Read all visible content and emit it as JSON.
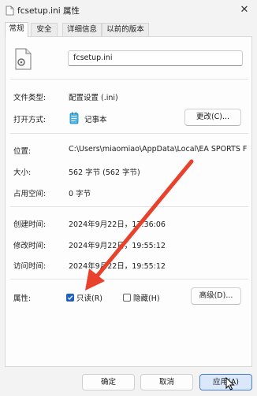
{
  "window": {
    "title": "fcsetup.ini 属性",
    "close_label": "✕"
  },
  "tabs": [
    {
      "label": "常规",
      "active": true
    },
    {
      "label": "安全",
      "active": false
    },
    {
      "label": "详细信息",
      "active": false
    },
    {
      "label": "以前的版本",
      "active": false
    }
  ],
  "file": {
    "name": "fcsetup.ini"
  },
  "rows": {
    "type_label": "文件类型:",
    "type_value": "配置设置 (.ini)",
    "open_label": "打开方式:",
    "open_value": "记事本",
    "change_button": "更改(C)...",
    "location_label": "位置:",
    "location_value": "C:\\Users\\miaomiao\\AppData\\Local\\EA SPORTS FC",
    "size_label": "大小:",
    "size_value": "562 字节 (562 字节)",
    "disk_label": "占用空间:",
    "disk_value": "0 字节",
    "created_label": "创建时间:",
    "created_value": "2024年9月22日，17:36:06",
    "modified_label": "修改时间:",
    "modified_value": "2024年9月22日，19:55:12",
    "accessed_label": "访问时间:",
    "accessed_value": "2024年9月22日，19:55:12",
    "attributes_label": "属性:",
    "readonly_label": "只读(R)",
    "readonly_checked": true,
    "hidden_label": "隐藏(H)",
    "hidden_checked": false,
    "advanced_button": "高级(D)..."
  },
  "footer": {
    "ok": "确定",
    "cancel": "取消",
    "apply": "应用(A)"
  },
  "colors": {
    "accent": "#1f5fbf",
    "arrow": "#e8412c"
  }
}
